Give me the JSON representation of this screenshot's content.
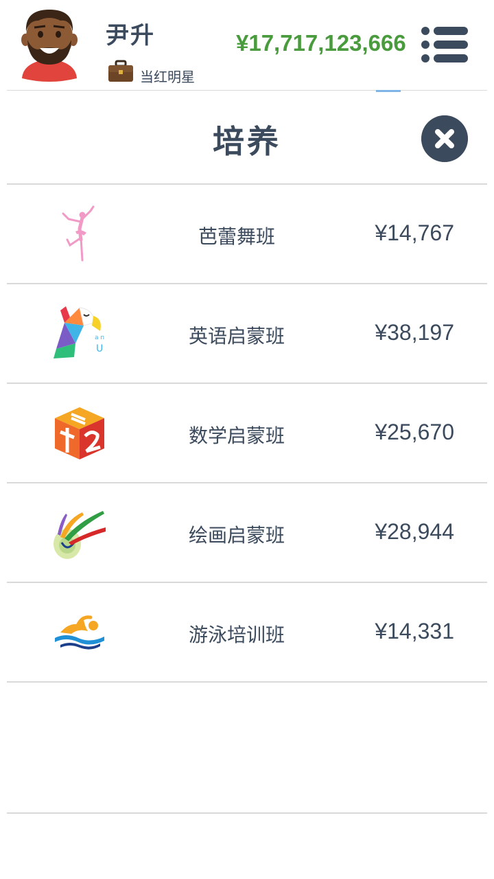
{
  "header": {
    "player_name": "尹升",
    "player_title": "当红明星",
    "money": "¥17,717,123,666",
    "avatar_icon": "avatar-man-beard-icon",
    "title_icon": "briefcase-icon",
    "menu_icon": "menu-list-icon",
    "money_color": "#4a9a3e"
  },
  "panel": {
    "title": "培养",
    "close_icon": "close-icon"
  },
  "courses": [
    {
      "name": "芭蕾舞班",
      "price": "¥14,767",
      "icon": "ballet-dancer-icon"
    },
    {
      "name": "英语启蒙班",
      "price": "¥38,197",
      "icon": "parrot-abc-icon"
    },
    {
      "name": "数学启蒙班",
      "price": "¥25,670",
      "icon": "math-cube-icon"
    },
    {
      "name": "绘画启蒙班",
      "price": "¥28,944",
      "icon": "paint-palette-icon"
    },
    {
      "name": "游泳培训班",
      "price": "¥14,331",
      "icon": "swimmer-icon"
    }
  ],
  "colors": {
    "text": "#3b4a5c",
    "divider": "#d9d9d9",
    "accent_tab": "#7fb4e6"
  }
}
